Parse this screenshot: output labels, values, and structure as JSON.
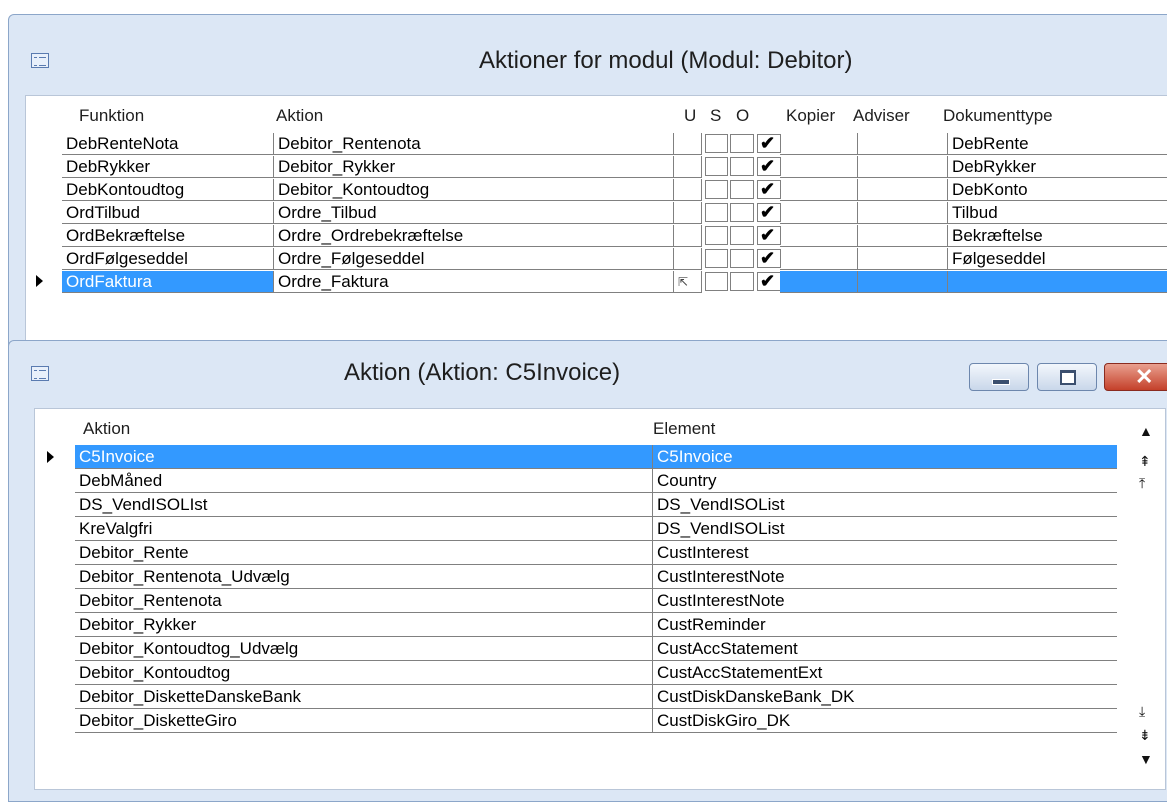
{
  "window1": {
    "title": "Aktioner for modul (Modul: Debitor)",
    "headers": {
      "funktion": "Funktion",
      "aktion": "Aktion",
      "u": "U",
      "s": "S",
      "o": "O",
      "kopier": "Kopier",
      "adviser": "Adviser",
      "dokumenttype": "Dokumenttype"
    },
    "rows": [
      {
        "funktion": "DebRenteNota",
        "aktion": "Debitor_Rentenota",
        "u": false,
        "s": false,
        "o": true,
        "dok": "DebRente"
      },
      {
        "funktion": "DebRykker",
        "aktion": "Debitor_Rykker",
        "u": false,
        "s": false,
        "o": true,
        "dok": "DebRykker"
      },
      {
        "funktion": "DebKontoudtog",
        "aktion": "Debitor_Kontoudtog",
        "u": false,
        "s": false,
        "o": true,
        "dok": "DebKonto"
      },
      {
        "funktion": "OrdTilbud",
        "aktion": "Ordre_Tilbud",
        "u": false,
        "s": false,
        "o": true,
        "dok": "Tilbud"
      },
      {
        "funktion": "OrdBekræftelse",
        "aktion": "Ordre_Ordrebekræftelse",
        "u": false,
        "s": false,
        "o": true,
        "dok": "Bekræftelse"
      },
      {
        "funktion": "OrdFølgeseddel",
        "aktion": "Ordre_Følgeseddel",
        "u": false,
        "s": false,
        "o": true,
        "dok": "Følgeseddel"
      },
      {
        "funktion": "OrdFaktura",
        "aktion": "Ordre_Faktura",
        "u": false,
        "s": false,
        "o": true,
        "dok": ""
      }
    ],
    "selected_row": 6
  },
  "window2": {
    "title": "Aktion (Aktion: C5Invoice)",
    "headers": {
      "aktion": "Aktion",
      "element": "Element"
    },
    "rows": [
      {
        "aktion": "C5Invoice",
        "element": "C5Invoice"
      },
      {
        "aktion": "DebMåned",
        "element": "Country"
      },
      {
        "aktion": "DS_VendISOLIst",
        "element": "DS_VendISOList"
      },
      {
        "aktion": "KreValgfri",
        "element": "DS_VendISOList"
      },
      {
        "aktion": "Debitor_Rente",
        "element": "CustInterest"
      },
      {
        "aktion": "Debitor_Rentenota_Udvælg",
        "element": "CustInterestNote"
      },
      {
        "aktion": "Debitor_Rentenota",
        "element": "CustInterestNote"
      },
      {
        "aktion": "Debitor_Rykker",
        "element": "CustReminder"
      },
      {
        "aktion": "Debitor_Kontoudtog_Udvælg",
        "element": "CustAccStatement"
      },
      {
        "aktion": "Debitor_Kontoudtog",
        "element": "CustAccStatementExt"
      },
      {
        "aktion": "Debitor_DisketteDanskeBank",
        "element": "CustDiskDanskeBank_DK"
      },
      {
        "aktion": "Debitor_DisketteGiro",
        "element": "CustDiskGiro_DK"
      }
    ],
    "selected_row": 0
  },
  "colors": {
    "selection": "#3399ff",
    "frame": "#dce7f5",
    "grid": "#808080",
    "close": "#c4402a"
  },
  "icons": {
    "window_menu": "window-menu-icon",
    "row_pointer": "row-pointer-icon",
    "checkmark": "checkmark-icon",
    "scroll_up": "scroll-up-icon",
    "scroll_down": "scroll-down-icon"
  }
}
